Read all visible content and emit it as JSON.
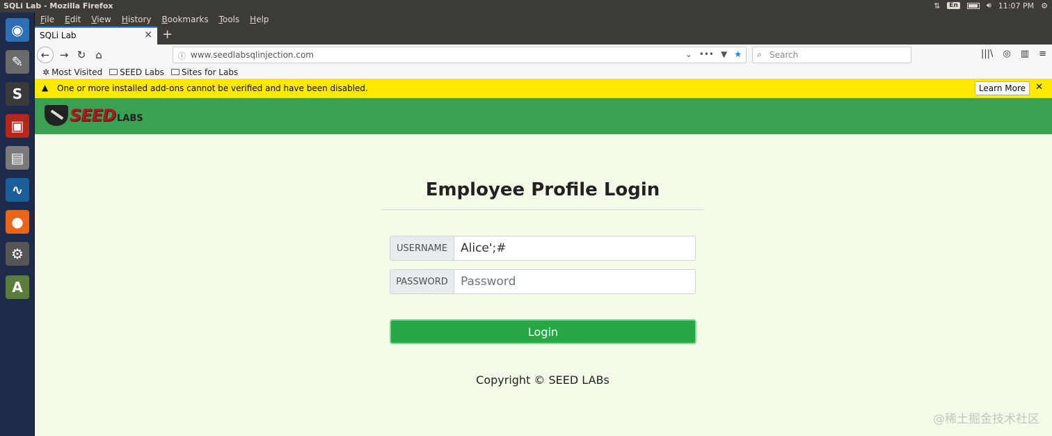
{
  "os": {
    "window_title": "SQLi Lab - Mozilla Firefox",
    "input_lang": "En",
    "clock": "11:07 PM"
  },
  "launcher": {
    "items": [
      {
        "name": "dash-home-icon",
        "glyph": "◉",
        "color": "#2e6fb5"
      },
      {
        "name": "text-editor-icon",
        "glyph": "✎",
        "color": "#6a6a6a"
      },
      {
        "name": "sublime-text-icon",
        "glyph": "S",
        "color": "#3a3a3a"
      },
      {
        "name": "terminal-app-icon",
        "glyph": "▣",
        "color": "#b3271c"
      },
      {
        "name": "file-manager-icon",
        "glyph": "▤",
        "color": "#7a7a7a"
      },
      {
        "name": "wireshark-icon",
        "glyph": "∿",
        "color": "#1a5e9a"
      },
      {
        "name": "firefox-icon",
        "glyph": "●",
        "color": "#e8651a"
      },
      {
        "name": "system-settings-icon",
        "glyph": "⚙",
        "color": "#555555"
      },
      {
        "name": "software-updater-icon",
        "glyph": "A",
        "color": "#5b7d3a"
      }
    ]
  },
  "menubar": {
    "items": [
      "File",
      "Edit",
      "View",
      "History",
      "Bookmarks",
      "Tools",
      "Help"
    ]
  },
  "tab": {
    "title": "SQLi Lab",
    "close": "×",
    "new": "+"
  },
  "navbar": {
    "url": "www.seedlabsqlinjection.com",
    "search_placeholder": "Search"
  },
  "bookmarks": {
    "items": [
      "Most Visited",
      "SEED Labs",
      "Sites for Labs"
    ]
  },
  "notice": {
    "message": "One or more installed add-ons cannot be verified and have been disabled.",
    "learn_more": "Learn More",
    "close": "✕"
  },
  "page": {
    "logo_word": "SEED",
    "logo_labs": "LABS",
    "title": "Employee Profile Login",
    "username_label": "USERNAME",
    "username_value": "Alice';#",
    "password_label": "PASSWORD",
    "password_placeholder": "Password",
    "login_button": "Login",
    "copyright": "Copyright © SEED LABs",
    "watermark": "@稀土掘金技术社区"
  }
}
